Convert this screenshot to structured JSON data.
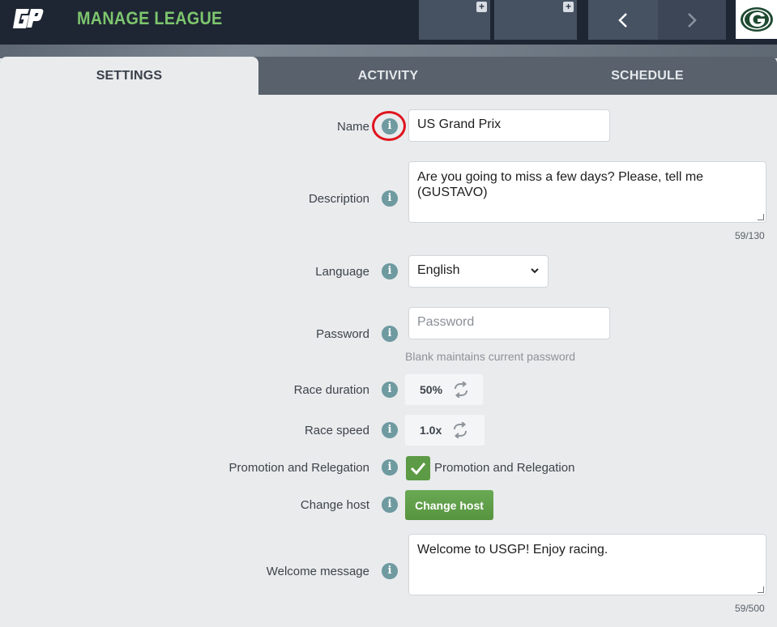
{
  "header": {
    "title": "MANAGE LEAGUE",
    "logo_icon": "gp-logo-icon",
    "slot_icon": "plus-icon",
    "prev_icon": "chevron-left-icon",
    "next_icon": "chevron-right-icon",
    "team_badge_icon": "packers-g-icon"
  },
  "tabs": [
    {
      "label": "SETTINGS",
      "active": true
    },
    {
      "label": "ACTIVITY",
      "active": false
    },
    {
      "label": "SCHEDULE",
      "active": false
    }
  ],
  "form": {
    "name": {
      "label": "Name",
      "value": "US Grand Prix"
    },
    "description": {
      "label": "Description",
      "value": "Are you going to miss a few days? Please, tell me (GUSTAVO)",
      "counter": "59/130"
    },
    "language": {
      "label": "Language",
      "value": "English"
    },
    "password": {
      "label": "Password",
      "placeholder": "Password",
      "hint": "Blank maintains current password"
    },
    "race_duration": {
      "label": "Race duration",
      "value": "50%"
    },
    "race_speed": {
      "label": "Race speed",
      "value": "1.0x"
    },
    "promotion": {
      "label": "Promotion and Relegation",
      "checkbox_label": "Promotion and Relegation",
      "checked": true
    },
    "change_host": {
      "label": "Change host",
      "button": "Change host"
    },
    "welcome": {
      "label": "Welcome message",
      "value": "Welcome to USGP! Enjoy racing.",
      "counter": "59/500"
    }
  },
  "colors": {
    "accent_green": "#7dc56e",
    "button_green": "#5c9a45",
    "info_icon": "#6e9aa0",
    "highlight_red": "#e0141e",
    "topbar": "#1e2633"
  }
}
